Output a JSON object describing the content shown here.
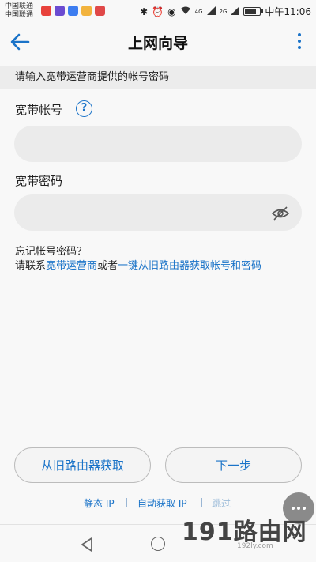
{
  "status_bar": {
    "carrier_1": "中国联通",
    "carrier_2": "中国联通",
    "signal_label_1": "4G",
    "signal_label_2": "2G",
    "time": "中午11:06",
    "battery_level": 0.8
  },
  "app_bar": {
    "title": "上网向导"
  },
  "banner": {
    "text": "请输入宽带运营商提供的帐号密码"
  },
  "account_field": {
    "label": "宽带帐号",
    "help": "?",
    "value": "",
    "placeholder": ""
  },
  "password_field": {
    "label": "宽带密码",
    "value": "",
    "placeholder": ""
  },
  "forgot": {
    "question": "忘记帐号密码？",
    "prefix": "请联系",
    "link_isp": "宽带运营商",
    "middle": "或者",
    "link_router": "一键从旧路由器获取帐号和密码"
  },
  "buttons": {
    "get_from_old": "从旧路由器获取",
    "next": "下一步"
  },
  "bottom_links": {
    "static_ip": "静态 IP",
    "auto_ip": "自动获取 IP",
    "skip": "跳过"
  },
  "watermark": {
    "text": "191路由网",
    "sub": "192ly.com"
  },
  "colors": {
    "accent": "#1a73c8",
    "background": "#f8f8f8",
    "input_bg": "#ebebeb"
  }
}
